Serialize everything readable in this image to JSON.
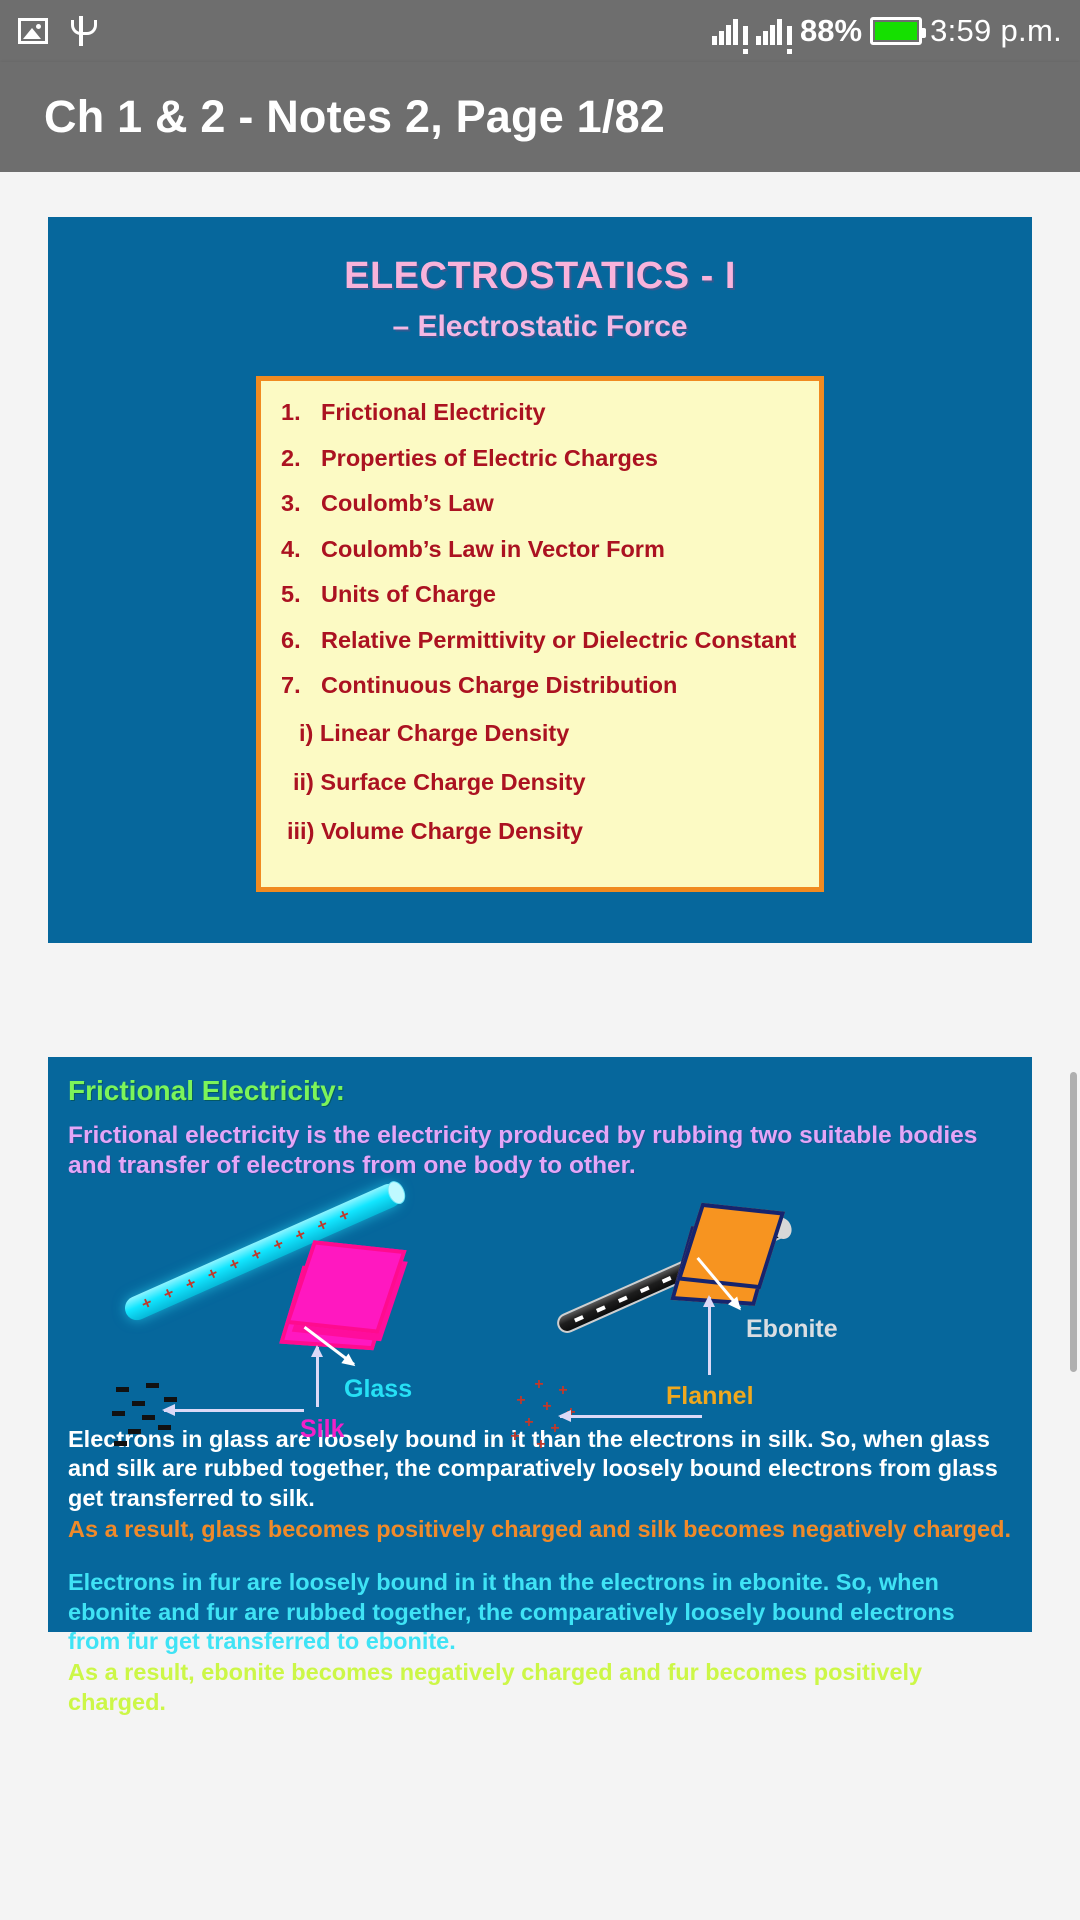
{
  "statusbar": {
    "icons": [
      "image-icon",
      "usb-icon",
      "signal-icon",
      "signal-icon"
    ],
    "battery_percent": "88%",
    "time": "3:59 p.m."
  },
  "appbar": {
    "title": "Ch 1 & 2 - Notes 2, Page 1/82"
  },
  "slide1": {
    "title": "ELECTROSTATICS - I",
    "subtitle": "– Electrostatic Force",
    "items": [
      {
        "num": "1.",
        "text": "Frictional Electricity"
      },
      {
        "num": "2.",
        "text": "Properties of Electric Charges"
      },
      {
        "num": "3.",
        "text": "Coulomb’s Law"
      },
      {
        "num": "4.",
        "text": "Coulomb’s Law in Vector Form"
      },
      {
        "num": "5.",
        "text": "Units of Charge"
      },
      {
        "num": "6.",
        "text": "Relative Permittivity or Dielectric Constant"
      },
      {
        "num": "7.",
        "text": "Continuous Charge Distribution"
      }
    ],
    "subitems": [
      "i) Linear Charge Density",
      "ii) Surface Charge Density",
      "iii) Volume Charge Density"
    ]
  },
  "slide2": {
    "heading": "Frictional Electricity:",
    "description": "Frictional electricity is the electricity produced by rubbing two suitable bodies and transfer of electrons from one body to other.",
    "labels": {
      "glass": "Glass",
      "silk": "Silk",
      "ebonite": "Ebonite",
      "flannel": "Flannel"
    },
    "paragraphs": [
      {
        "color": "#ffffff",
        "text": "Electrons in glass are loosely bound in it than the electrons in silk.  So, when glass and silk are rubbed together, the comparatively loosely bound electrons from glass get transferred to silk."
      },
      {
        "color": "#f08a2a",
        "text": "As a result, glass becomes positively charged and silk becomes negatively charged."
      },
      {
        "color": "#3fe3f5",
        "text": "Electrons in fur are loosely bound in it than the electrons in ebonite.  So, when ebonite and fur  are rubbed together, the comparatively loosely bound electrons from fur get transferred to ebonite."
      },
      {
        "color": "#ccf747",
        "text": "As a result, ebonite becomes negatively charged and fur becomes positively charged."
      }
    ]
  },
  "colors": {
    "slide_bg": "#06679c",
    "listbox_bg": "#fcfac4",
    "listbox_border": "#f08a20",
    "title_pink": "#f9b3db",
    "list_red": "#ab1221",
    "statusbar_bg": "#6e6e6e",
    "battery_green": "#15e000"
  }
}
